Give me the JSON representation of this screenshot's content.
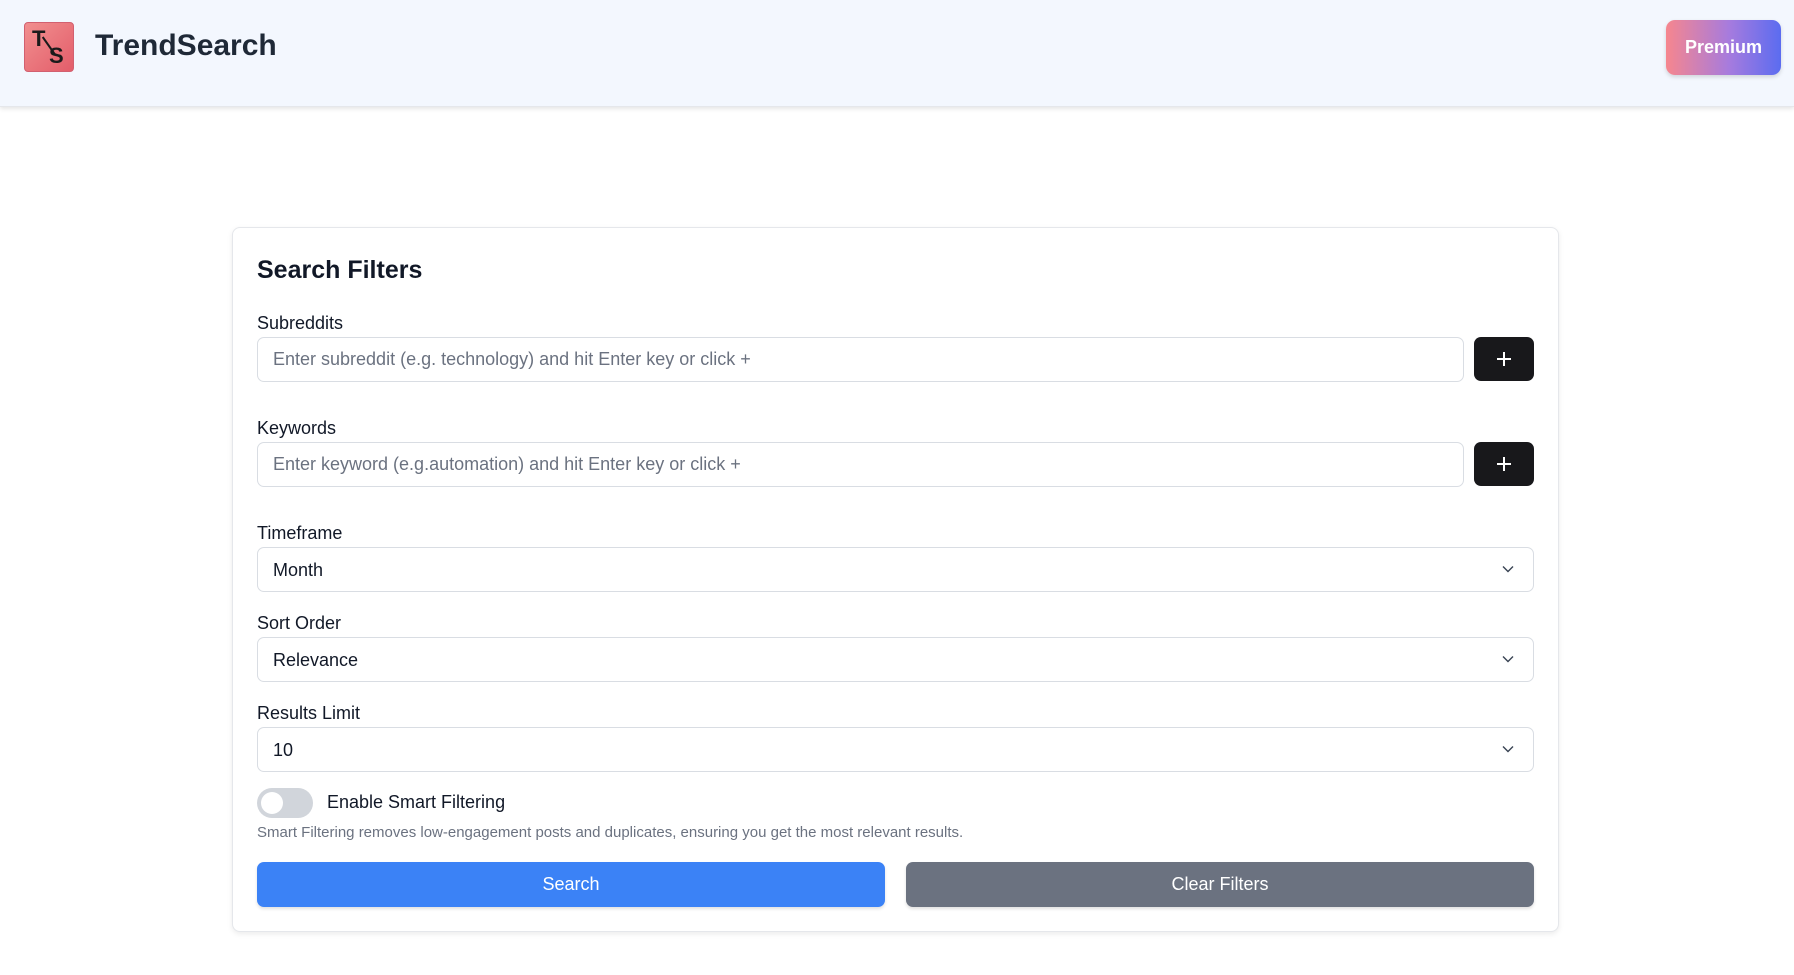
{
  "header": {
    "logo_top": "T",
    "logo_bottom": "S",
    "brand": "TrendSearch",
    "premium_label": "Premium"
  },
  "filters": {
    "title": "Search Filters",
    "subreddits": {
      "label": "Subreddits",
      "placeholder": "Enter subreddit (e.g. technology) and hit Enter key or click +",
      "value": ""
    },
    "keywords": {
      "label": "Keywords",
      "placeholder": "Enter keyword (e.g.automation) and hit Enter key or click +",
      "value": ""
    },
    "timeframe": {
      "label": "Timeframe",
      "selected": "Month"
    },
    "sort_order": {
      "label": "Sort Order",
      "selected": "Relevance"
    },
    "results_limit": {
      "label": "Results Limit",
      "selected": "10"
    },
    "smart_filtering": {
      "label": "Enable Smart Filtering",
      "enabled": false,
      "help": "Smart Filtering removes low-engagement posts and duplicates, ensuring you get the most relevant results."
    },
    "search_label": "Search",
    "clear_label": "Clear Filters"
  },
  "colors": {
    "primary": "#3b82f6",
    "secondary": "#6b7280",
    "add_button": "#18181b",
    "header_bg": "#f3f7fe"
  },
  "icons": {
    "add": "plus-icon",
    "dropdown": "chevron-down-icon"
  }
}
